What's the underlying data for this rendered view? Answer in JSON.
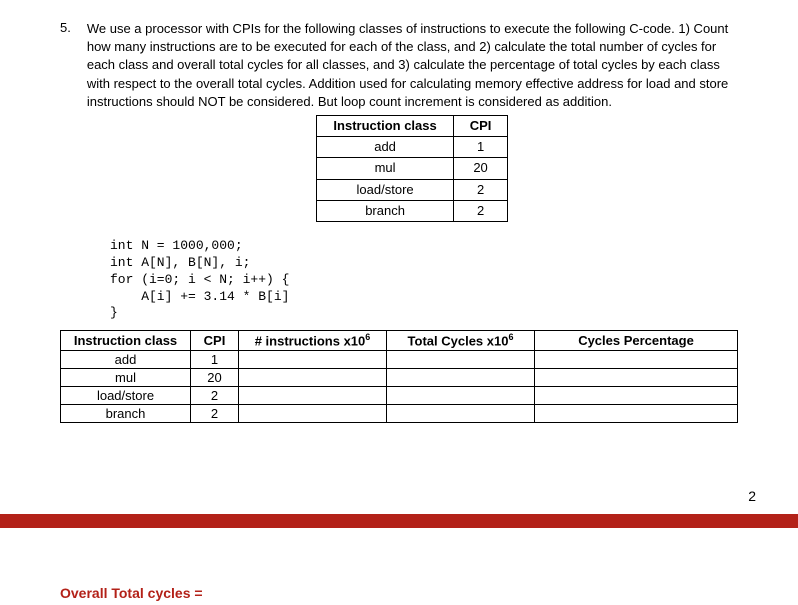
{
  "question_number": "5.",
  "question_text": "We use a processor with CPIs for the following classes of instructions to execute the following C-code. 1) Count how many instructions are to be executed for each of the class, and 2) calculate the total number of cycles for each class and overall total cycles for all classes, and 3) calculate the percentage of total cycles by each class with respect to the overall total cycles. Addition used for calculating memory effective address for load and store instructions should NOT be considered. But loop count increment is considered as addition.",
  "cpi_headers": {
    "class": "Instruction class",
    "cpi": "CPI"
  },
  "cpi_rows": [
    {
      "class": "add",
      "cpi": "1"
    },
    {
      "class": "mul",
      "cpi": "20"
    },
    {
      "class": "load/store",
      "cpi": "2"
    },
    {
      "class": "branch",
      "cpi": "2"
    }
  ],
  "code_lines": [
    "int N = 1000,000;",
    "int A[N], B[N], i;",
    "for (i=0; i < N; i++) {",
    "    A[i] += 3.14 * B[i]",
    "}"
  ],
  "calc_headers": {
    "class": "Instruction class",
    "cpi": "CPI",
    "instr": "# instructions x10",
    "instr_sup": "6",
    "total": "Total Cycles x10",
    "total_sup": "6",
    "pct": "Cycles Percentage"
  },
  "calc_rows": [
    {
      "class": "add",
      "cpi": "1",
      "instr": "",
      "total": "",
      "pct": ""
    },
    {
      "class": "mul",
      "cpi": "20",
      "instr": "",
      "total": "",
      "pct": ""
    },
    {
      "class": "load/store",
      "cpi": "2",
      "instr": "",
      "total": "",
      "pct": ""
    },
    {
      "class": "branch",
      "cpi": "2",
      "instr": "",
      "total": "",
      "pct": ""
    }
  ],
  "page_number": "2",
  "overall_label": "Overall Total cycles ="
}
